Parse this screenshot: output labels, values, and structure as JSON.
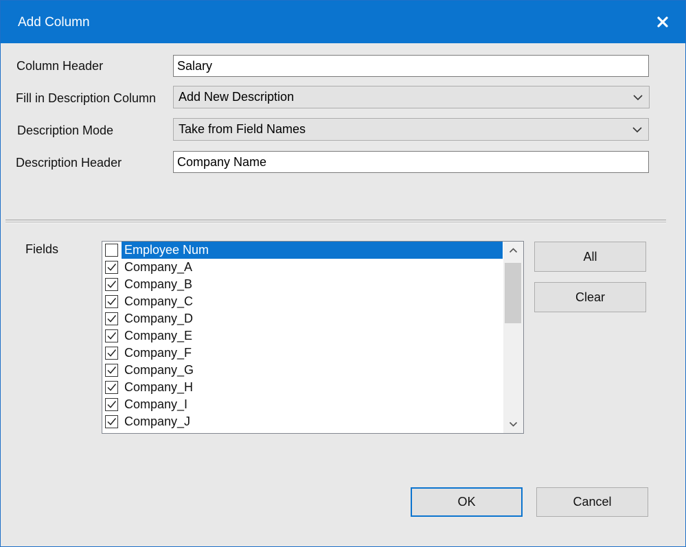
{
  "dialog": {
    "title": "Add Column",
    "close_icon": "close-icon"
  },
  "form": {
    "column_header_label": "Column Header",
    "column_header_value": "Salary",
    "fill_desc_label": "Fill in Description Column",
    "fill_desc_value": "Add New Description",
    "desc_mode_label": "Description Mode",
    "desc_mode_value": "Take from Field Names",
    "desc_header_label": "Description Header",
    "desc_header_value": "Company Name"
  },
  "fields": {
    "label": "Fields",
    "items": [
      {
        "label": "Employee Num",
        "checked": false,
        "selected": true
      },
      {
        "label": "Company_A",
        "checked": true,
        "selected": false
      },
      {
        "label": "Company_B",
        "checked": true,
        "selected": false
      },
      {
        "label": "Company_C",
        "checked": true,
        "selected": false
      },
      {
        "label": "Company_D",
        "checked": true,
        "selected": false
      },
      {
        "label": "Company_E",
        "checked": true,
        "selected": false
      },
      {
        "label": "Company_F",
        "checked": true,
        "selected": false
      },
      {
        "label": "Company_G",
        "checked": true,
        "selected": false
      },
      {
        "label": "Company_H",
        "checked": true,
        "selected": false
      },
      {
        "label": "Company_I",
        "checked": true,
        "selected": false
      },
      {
        "label": "Company_J",
        "checked": true,
        "selected": false
      }
    ],
    "all_label": "All",
    "clear_label": "Clear"
  },
  "footer": {
    "ok_label": "OK",
    "cancel_label": "Cancel"
  },
  "colors": {
    "accent": "#0b74cf",
    "background": "#e8e8e8"
  }
}
